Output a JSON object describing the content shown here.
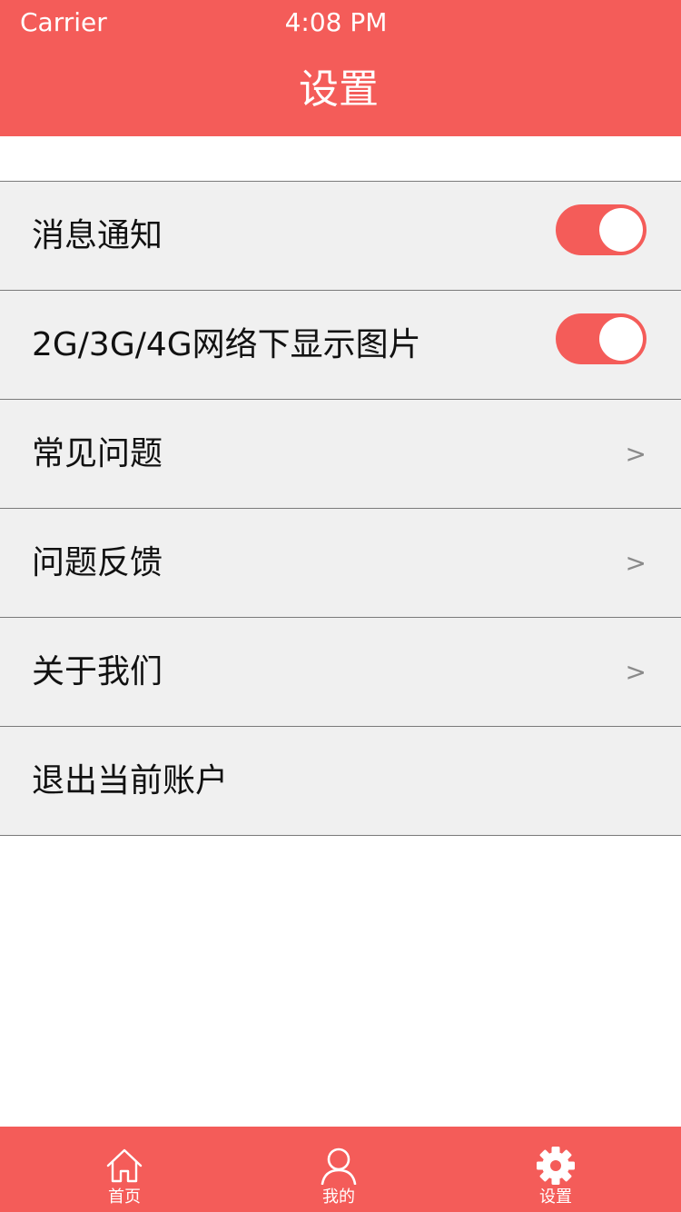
{
  "status_bar": {
    "carrier": "Carrier",
    "time": "4:08 PM"
  },
  "nav": {
    "title": "设置"
  },
  "settings": {
    "items": [
      {
        "label": "消息通知",
        "type": "toggle",
        "on": true
      },
      {
        "label": "2G/3G/4G网络下显示图片",
        "type": "toggle",
        "on": true
      },
      {
        "label": "常见问题",
        "type": "link",
        "chevron": ">"
      },
      {
        "label": "问题反馈",
        "type": "link",
        "chevron": ">"
      },
      {
        "label": "关于我们",
        "type": "link",
        "chevron": ">"
      },
      {
        "label": "退出当前账户",
        "type": "action"
      }
    ]
  },
  "tabbar": {
    "tabs": [
      {
        "label": "首页",
        "icon": "home-icon"
      },
      {
        "label": "我的",
        "icon": "user-icon"
      },
      {
        "label": "设置",
        "icon": "gear-icon",
        "active": true
      }
    ]
  },
  "colors": {
    "accent": "#f45c59",
    "row_background": "#f0f0f0",
    "divider": "#7a7a7a"
  }
}
